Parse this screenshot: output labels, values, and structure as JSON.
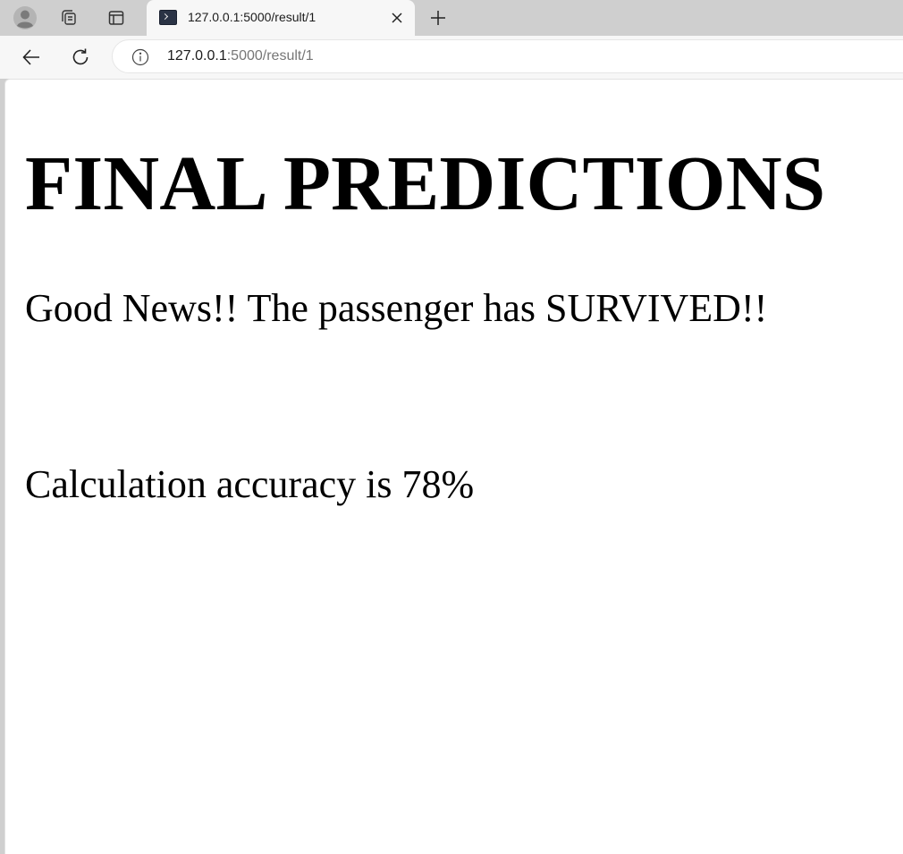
{
  "browser": {
    "tab": {
      "title": "127.0.0.1:5000/result/1",
      "favicon": "terminal-icon"
    },
    "address_bar": {
      "host": "127.0.0.1",
      "path": ":5000/result/1"
    },
    "icons": {
      "profile": "profile-avatar-icon",
      "workspaces": "workspaces-icon",
      "tab_actions": "tab-actions-icon",
      "close": "close-icon",
      "new_tab": "plus-icon",
      "back": "back-arrow-icon",
      "refresh": "refresh-icon",
      "site_info": "info-icon"
    },
    "colors": {
      "tab_strip": "#cfcfcf",
      "toolbar": "#f7f7f7",
      "url_host": "#1b1b1b",
      "url_path": "#767676"
    }
  },
  "page": {
    "heading": "FINAL PREDICTIONS",
    "prediction": "Good News!! The passenger has SURVIVED!!",
    "accuracy": "Calculation accuracy is 78%"
  }
}
